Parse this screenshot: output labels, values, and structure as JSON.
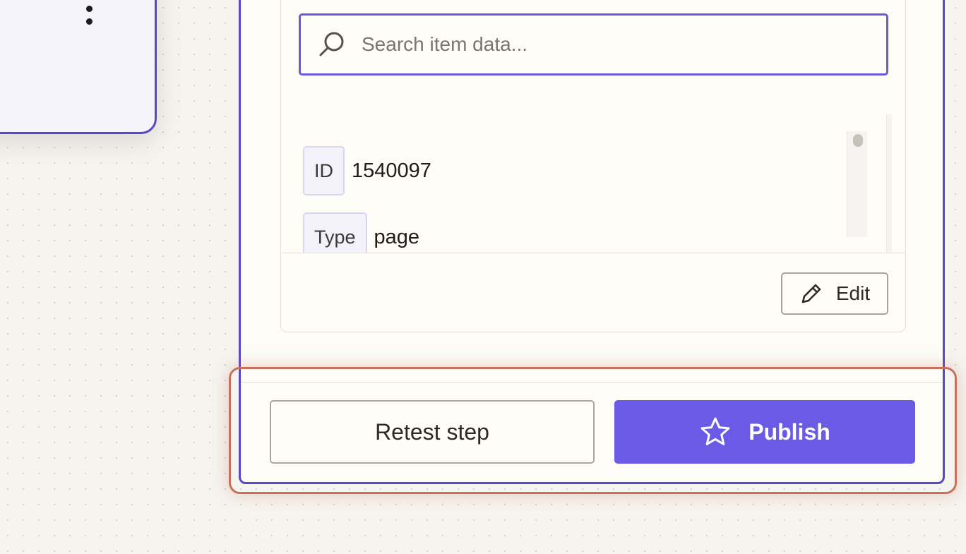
{
  "node_card": {
    "menu_icon": "kebab-icon"
  },
  "search": {
    "placeholder": "Search item data...",
    "value": "",
    "icon": "search-icon"
  },
  "item_data": [
    {
      "key": "ID",
      "value": "1540097"
    },
    {
      "key": "Type",
      "value": "page"
    }
  ],
  "edit_button": {
    "label": "Edit",
    "icon": "pencil-icon"
  },
  "footer": {
    "retest_label": "Retest step",
    "publish_label": "Publish",
    "publish_icon": "star-icon"
  },
  "colors": {
    "accent": "#6b5ae6",
    "panel_border": "#5a47c8",
    "highlight": "#c8705f",
    "background": "#f6f4ef"
  }
}
